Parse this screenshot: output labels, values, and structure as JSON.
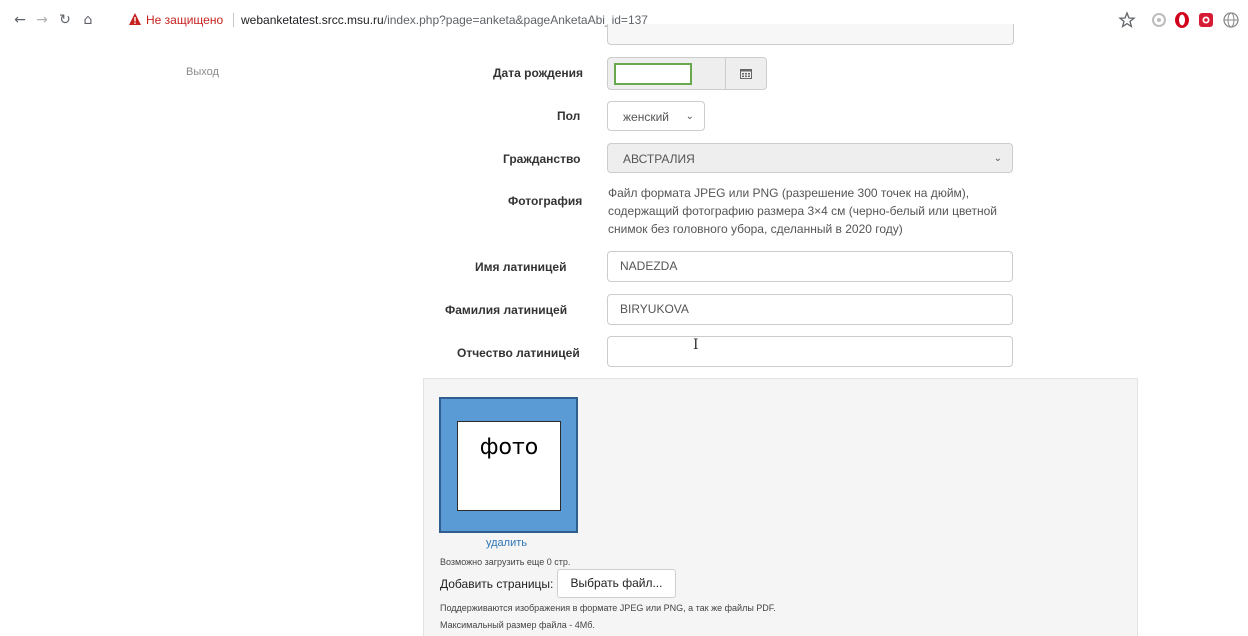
{
  "browser": {
    "security_label": "Не защищено",
    "url_host": "webanketatest.srcc.msu.ru",
    "url_path": "/index.php?page=anketa&pageAnketaAbi_id=137",
    "icons": {
      "back": "arrow-left-icon",
      "forward": "arrow-right-icon",
      "reload": "reload-icon",
      "home": "home-icon",
      "warning": "warning-triangle-icon",
      "bookmark": "star-icon"
    }
  },
  "sidebar": {
    "logout_label": "Выход"
  },
  "form": {
    "birth_date": {
      "label": "Дата рождения",
      "value": ""
    },
    "gender": {
      "label": "Пол",
      "value": "женский"
    },
    "citizenship": {
      "label": "Гражданство",
      "value": "АВСТРАЛИЯ"
    },
    "photo": {
      "label": "Фотография",
      "help": "Файл формата JPEG или PNG (разрешение 300 точек на дюйм), содержащий фотографию размера 3×4 см (черно-белый или цветной снимок без головного убора, сделанный в 2020 году)"
    },
    "first_name_latin": {
      "label": "Имя латиницей",
      "value": "NADEZDA"
    },
    "last_name_latin": {
      "label": "Фамилия латиницей",
      "value": "BIRYUKOVA"
    },
    "patronymic_latin": {
      "label": "Отчество латиницей",
      "value": ""
    }
  },
  "upload": {
    "thumbnail_text": "фото",
    "delete_label": "удалить",
    "remaining_text": "Возможно загрузить еще 0 стр.",
    "add_pages_label": "Добавить страницы:",
    "choose_file_label": "Выбрать файл...",
    "formats_note": "Поддерживаются изображения в формате JPEG или PNG, а так же файлы PDF.",
    "max_size_note": "Максимальный размер файла - 4Мб."
  },
  "colors": {
    "insecure": "#c5221f",
    "link": "#2e75b6",
    "photo_frame": "#5b9bd5",
    "date_focus": "#6aa84f"
  }
}
